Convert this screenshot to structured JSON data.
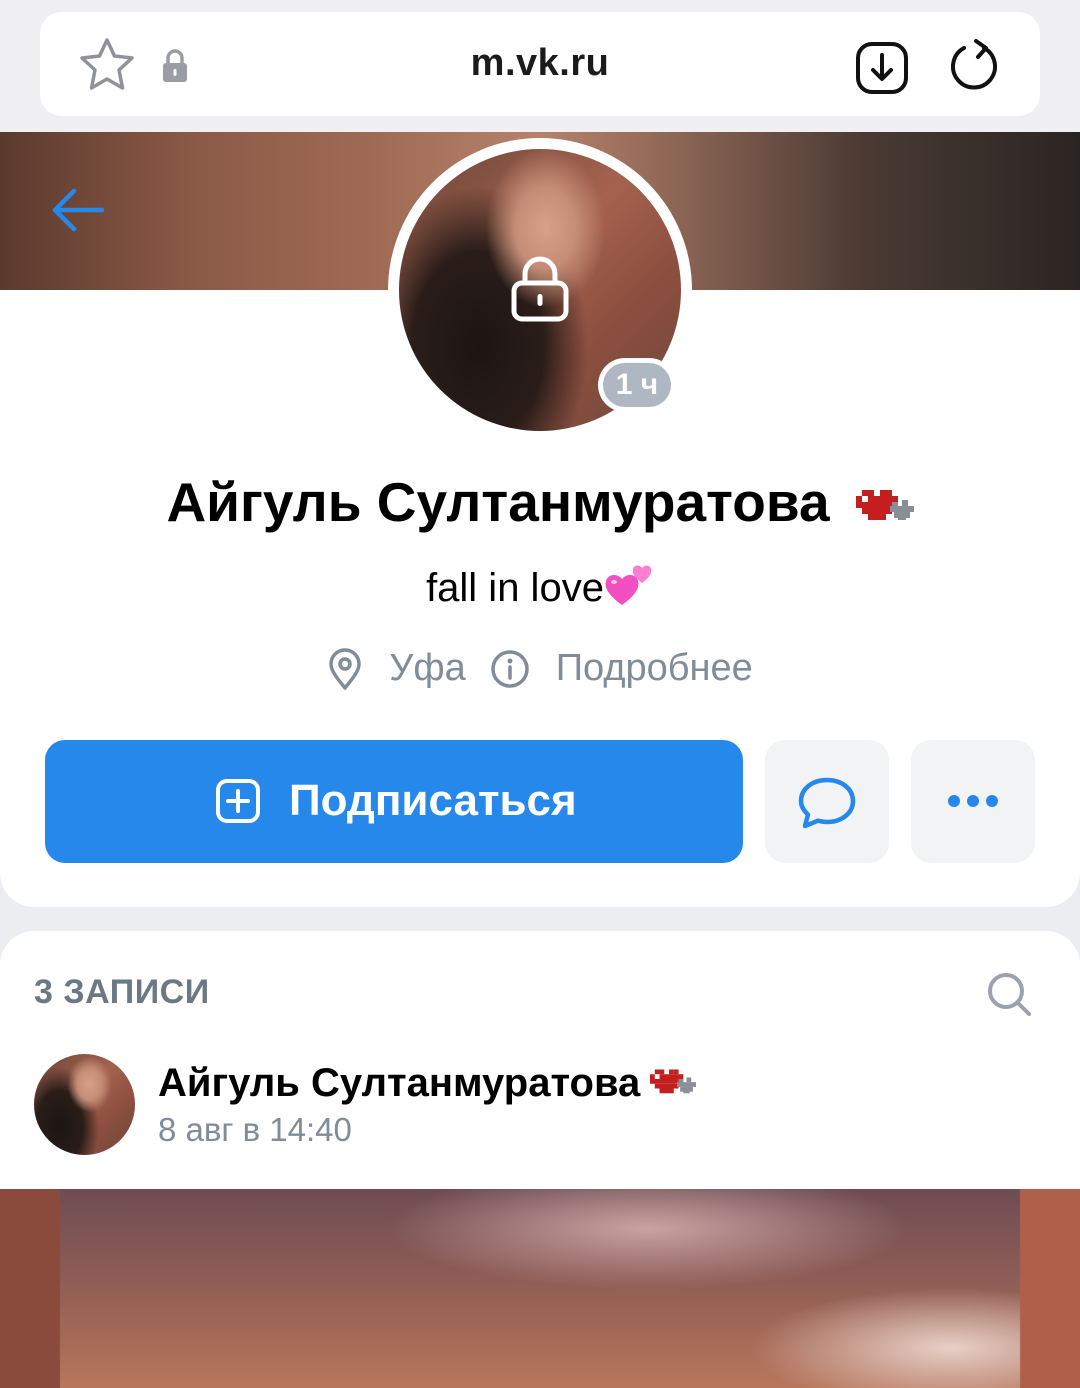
{
  "browser": {
    "url": "m.vk.ru"
  },
  "profile": {
    "name": "Айгуль Султанмуратова",
    "status": "fall in love",
    "online_badge": "1 ч",
    "city": "Уфа",
    "details_link": "Подробнее",
    "subscribe_label": "Подписаться"
  },
  "posts": {
    "count_label": "3 ЗАПИСИ",
    "items": [
      {
        "author": "Айгуль Султанмуратова",
        "date": "8 авг в 14:40"
      }
    ]
  },
  "colors": {
    "accent": "#2688eb",
    "secondary_text": "#818c99",
    "button_bg": "#f2f3f5",
    "page_bg": "#ebedf0"
  },
  "icons": [
    "star-icon",
    "lock-icon",
    "download-icon",
    "reload-icon",
    "back-arrow-icon",
    "pin-icon",
    "info-icon",
    "plus-square-icon",
    "message-icon",
    "more-icon",
    "search-icon"
  ]
}
